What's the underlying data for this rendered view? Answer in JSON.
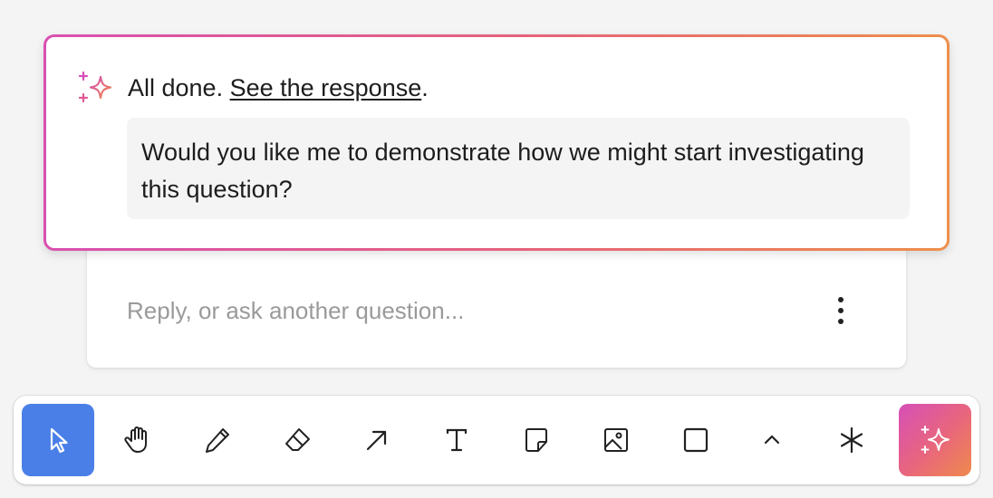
{
  "ai_card": {
    "status_prefix": "All done. ",
    "response_link": "See the response",
    "status_suffix": ".",
    "suggestion": "Would you like me to demonstrate how we might start investigating this question?"
  },
  "reply": {
    "placeholder": "Reply, or ask another question..."
  },
  "toolbar": {
    "tools": [
      {
        "name": "select",
        "icon": "cursor-arrow-icon",
        "active": true
      },
      {
        "name": "hand",
        "icon": "hand-icon"
      },
      {
        "name": "draw",
        "icon": "pencil-icon"
      },
      {
        "name": "eraser",
        "icon": "eraser-icon"
      },
      {
        "name": "arrow",
        "icon": "arrow-icon"
      },
      {
        "name": "text",
        "icon": "text-icon"
      },
      {
        "name": "note",
        "icon": "sticky-note-icon"
      },
      {
        "name": "image",
        "icon": "image-icon"
      },
      {
        "name": "rectangle",
        "icon": "rectangle-icon"
      },
      {
        "name": "more",
        "icon": "chevron-up-icon"
      },
      {
        "name": "laser",
        "icon": "asterisk-icon"
      },
      {
        "name": "ai",
        "icon": "sparkle-icon"
      }
    ]
  },
  "colors": {
    "active_tool": "#4a7fe8",
    "gradient_start": "#d94fb1",
    "gradient_end": "#ee8f4a",
    "placeholder": "#9a9a9a"
  }
}
